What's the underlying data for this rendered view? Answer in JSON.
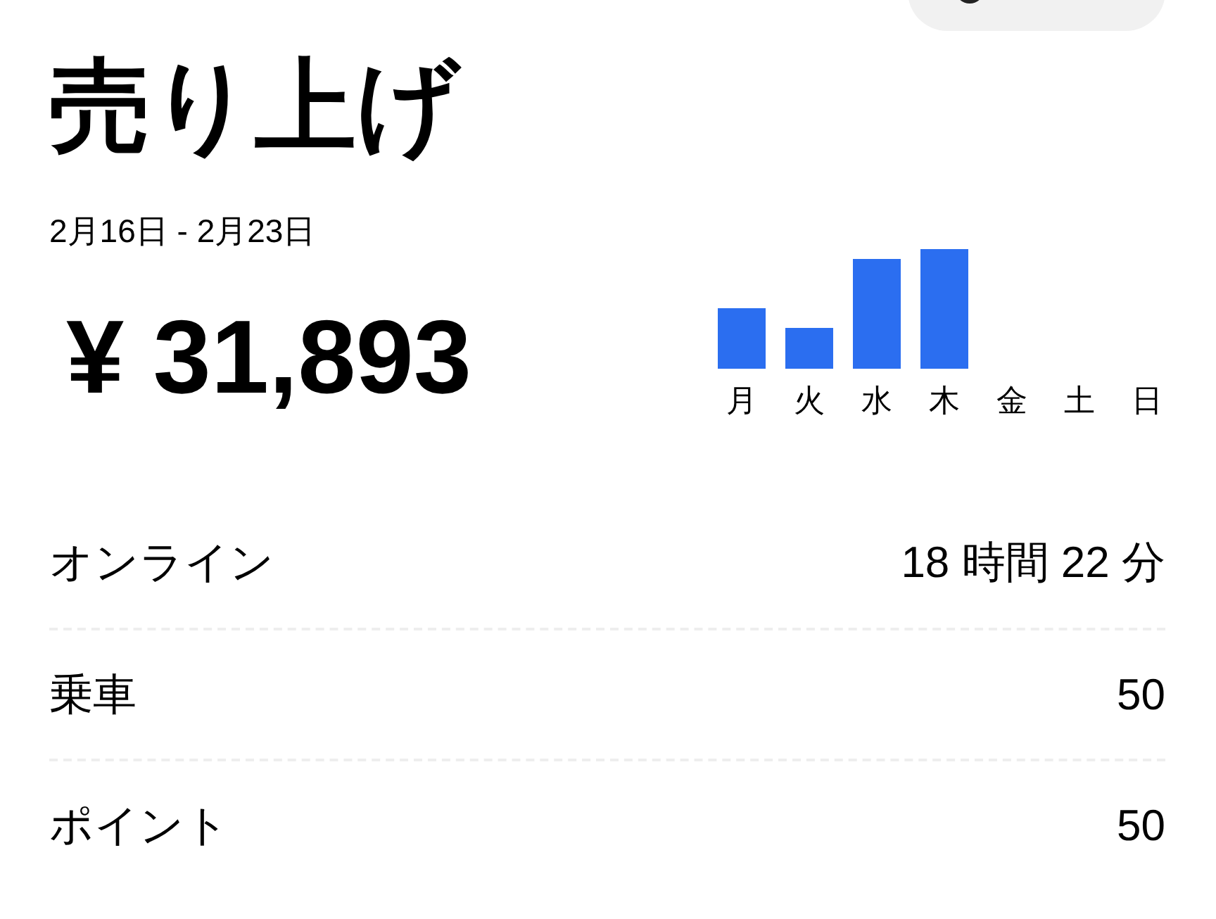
{
  "title": "売り上げ",
  "date_range": "2月16日 - 2月23日",
  "total": "¥ 31,893",
  "chart": {
    "days": [
      "月",
      "火",
      "水",
      "木",
      "金",
      "土",
      "日"
    ]
  },
  "stats": [
    {
      "label": "オンライン",
      "value": "18 時間 22 分"
    },
    {
      "label": "乗車",
      "value": "50"
    },
    {
      "label": "ポイント",
      "value": "50"
    }
  ]
}
